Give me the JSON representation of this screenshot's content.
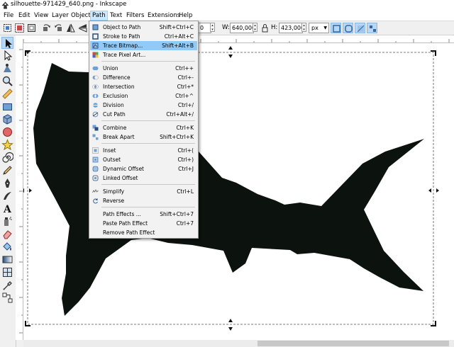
{
  "window": {
    "title": "silhouette-971429_640.png - Inkscape"
  },
  "menubar": {
    "items": [
      "File",
      "Edit",
      "View",
      "Layer",
      "Object",
      "Path",
      "Text",
      "Filters",
      "Extensions",
      "Help"
    ],
    "active": "Path"
  },
  "toolbar": {
    "x_value": "0",
    "w_label": "W:",
    "w_value": "640,000",
    "h_label": "H:",
    "h_value": "423,000",
    "unit": "px"
  },
  "path_menu": {
    "items": [
      {
        "label": "Object to Path",
        "shortcut": "Shift+Ctrl+C",
        "icon": "object-to-path-icon"
      },
      {
        "label": "Stroke to Path",
        "shortcut": "Ctrl+Alt+C",
        "icon": "stroke-to-path-icon"
      },
      {
        "label": "Trace Bitmap...",
        "shortcut": "Shift+Alt+B",
        "icon": "trace-bitmap-icon",
        "highlighted": true
      },
      {
        "label": "Trace Pixel Art...",
        "shortcut": "",
        "icon": "trace-pixel-art-icon"
      },
      {
        "label": "Union",
        "shortcut": "Ctrl++",
        "icon": "union-icon"
      },
      {
        "label": "Difference",
        "shortcut": "Ctrl+-",
        "icon": "difference-icon"
      },
      {
        "label": "Intersection",
        "shortcut": "Ctrl+*",
        "icon": "intersection-icon"
      },
      {
        "label": "Exclusion",
        "shortcut": "Ctrl+^",
        "icon": "exclusion-icon"
      },
      {
        "label": "Division",
        "shortcut": "Ctrl+/",
        "icon": "division-icon"
      },
      {
        "label": "Cut Path",
        "shortcut": "Ctrl+Alt+/",
        "icon": "cut-path-icon"
      },
      {
        "label": "Combine",
        "shortcut": "Ctrl+K",
        "icon": "combine-icon"
      },
      {
        "label": "Break Apart",
        "shortcut": "Shift+Ctrl+K",
        "icon": "break-apart-icon"
      },
      {
        "label": "Inset",
        "shortcut": "Ctrl+(",
        "icon": "inset-icon"
      },
      {
        "label": "Outset",
        "shortcut": "Ctrl+)",
        "icon": "outset-icon"
      },
      {
        "label": "Dynamic Offset",
        "shortcut": "Ctrl+J",
        "icon": "dynamic-offset-icon"
      },
      {
        "label": "Linked Offset",
        "shortcut": "",
        "icon": "linked-offset-icon"
      },
      {
        "label": "Simplify",
        "shortcut": "Ctrl+L",
        "icon": "simplify-icon"
      },
      {
        "label": "Reverse",
        "shortcut": "",
        "icon": "reverse-icon"
      },
      {
        "label": "Path Effects ...",
        "shortcut": "Shift+Ctrl+7",
        "icon": ""
      },
      {
        "label": "Paste Path Effect",
        "shortcut": "Ctrl+7",
        "icon": ""
      },
      {
        "label": "Remove Path Effect",
        "shortcut": "",
        "icon": ""
      }
    ]
  },
  "colors": {
    "accent": "#91c9f7",
    "silhouette": "#0c120e"
  }
}
